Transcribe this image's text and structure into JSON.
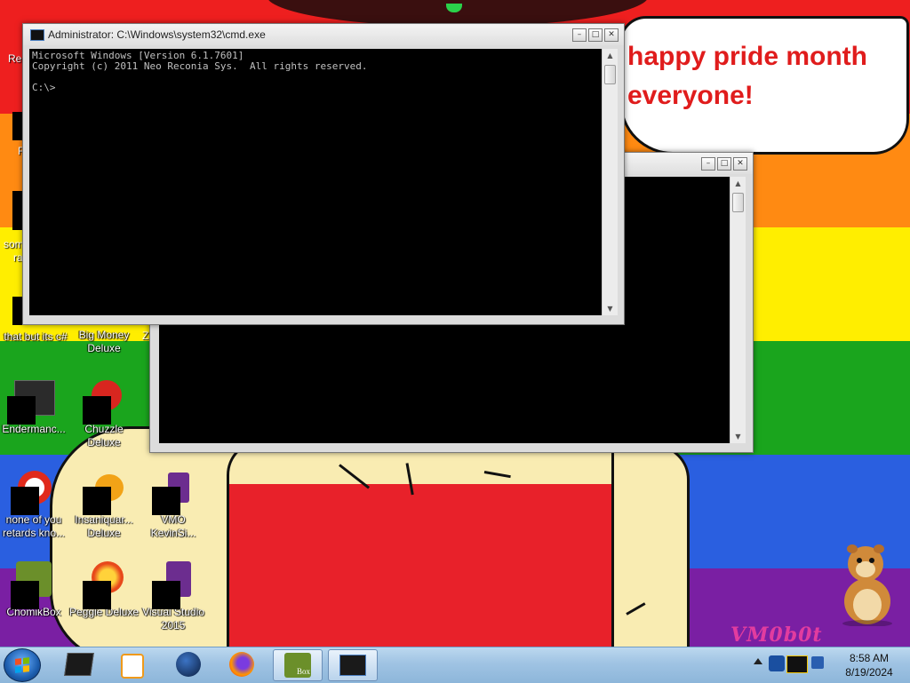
{
  "speech_bubble": {
    "line1": "happy pride month",
    "line2": "everyone!"
  },
  "watermark": "VM0b0t",
  "desktop_icons": [
    {
      "id": "that-but-its-csharp",
      "label_line1": "that but its c#",
      "label_line2": ""
    },
    {
      "id": "big-money-deluxe",
      "label_line1": "Big Money",
      "label_line2": "Deluxe"
    },
    {
      "id": "endermancer",
      "label_line1": "Endermanc...",
      "label_line2": ""
    },
    {
      "id": "chuzzle-deluxe",
      "label_line1": "Chuzzle",
      "label_line2": "Deluxe"
    },
    {
      "id": "none-of-you",
      "label_line1": "none of you",
      "label_line2": "retards kno..."
    },
    {
      "id": "insaniquarium",
      "label_line1": "Insaniquar...",
      "label_line2": "Deluxe"
    },
    {
      "id": "vmo-kevinsi",
      "label_line1": "VMO",
      "label_line2": "KevinSi..."
    },
    {
      "id": "chomikbox",
      "label_line1": "ChomikBox",
      "label_line2": ""
    },
    {
      "id": "peggle-deluxe",
      "label_line1": "Peggle Deluxe",
      "label_line2": ""
    },
    {
      "id": "visual-studio-2015",
      "label_line1": "Visual Studio",
      "label_line2": "2015"
    }
  ],
  "partial_labels": {
    "top": "Re",
    "left1": "R",
    "left2a": "som",
    "left2b": "ra",
    "col3": "Z"
  },
  "cmd_window": {
    "title": "Administrator: C:\\Windows\\system32\\cmd.exe",
    "output": "Microsoft Windows [Version 6.1.7601]\nCopyright (c) 2011 Neo Reconia Sys.  All rights reserved.\n\nC:\\>"
  },
  "back_window": {
    "title": ""
  },
  "window_controls": {
    "minimize": "–",
    "maximize": "□",
    "close": "✕"
  },
  "taskbar": {
    "items": [
      {
        "name": "cmd-taskbar-item",
        "icon": "terminal-icon"
      },
      {
        "name": "media-player-taskbar-item",
        "icon": "play-icon"
      },
      {
        "name": "globe-taskbar-item",
        "icon": "globe-icon"
      },
      {
        "name": "firefox-taskbar-item",
        "icon": "firefox-icon"
      },
      {
        "name": "chomikbox-taskbar-item",
        "icon": "hamster-icon"
      },
      {
        "name": "window-taskbar-item",
        "icon": "window-icon"
      }
    ],
    "box_label": "Box"
  },
  "clock": {
    "time": "8:58 AM",
    "date": "8/19/2024"
  },
  "colors": {
    "rainbow": [
      "#ee1f1f",
      "#ff8a12",
      "#ffee00",
      "#1aa51d",
      "#2a5fe0",
      "#7a1fa3"
    ],
    "bubble_text": "#e01c1c",
    "watermark": "#e23c9f"
  }
}
